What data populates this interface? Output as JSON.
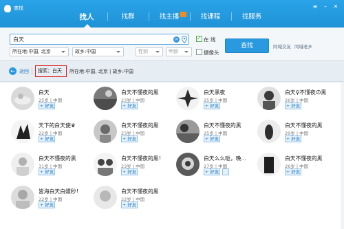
{
  "app": {
    "title": "查找"
  },
  "window": {
    "menu_icon": "menu-icon",
    "minimize_icon": "minimize-icon",
    "close_icon": "close-icon"
  },
  "tabs": [
    {
      "label": "找人",
      "active": true
    },
    {
      "label": "找群",
      "active": false
    },
    {
      "label": "找主播",
      "active": false
    },
    {
      "label": "找课程",
      "active": false
    },
    {
      "label": "找服务",
      "active": false
    }
  ],
  "search": {
    "query": "白天",
    "online_label": "在 线",
    "online_checked": true,
    "camera_label": "摄像头",
    "camera_checked": false,
    "location": "所在地:中国, 北京",
    "hometown": "故乡:中国",
    "gender_placeholder": "性别",
    "age_placeholder": "年龄",
    "button_label": "查找",
    "side_links": [
      "同城交友",
      "同城老乡"
    ]
  },
  "breadcrumb": {
    "back_label": "返回",
    "search_term": "搜索：白天",
    "filters": "所在地:中国, 北京 | 故乡:中国"
  },
  "results": [
    {
      "name": "白天",
      "meta": "25岁 | 中国",
      "add_label": "+ 好友"
    },
    {
      "name": "白天不懂夜的黑",
      "meta": "23岁 | 中国",
      "add_label": "+ 好友"
    },
    {
      "name": "白天黑夜",
      "meta": "25岁 | 中国",
      "add_label": "+ 好友"
    },
    {
      "name": "白天♀不懂夜の黑",
      "meta": "26岁 | 中国",
      "add_label": "+ 好友"
    },
    {
      "name": "天下的白天使♛",
      "meta": "22岁 | 中国",
      "add_label": "+ 好友"
    },
    {
      "name": "白天不懂夜的黑",
      "meta": "23岁 | 中国",
      "add_label": "+ 好友"
    },
    {
      "name": "白天不懂夜的黑",
      "meta": "25岁 | 中国",
      "add_label": "+ 好友"
    },
    {
      "name": "白天不懂夜的黑",
      "meta": "29岁 | 中国",
      "add_label": "+ 好友"
    },
    {
      "name": "白天不懂夜的黑",
      "meta": "31岁 | 中国",
      "add_label": "+ 好友"
    },
    {
      "name": "白天不懂夜的黑！",
      "meta": "23岁 | 中国",
      "add_label": "+ 好友"
    },
    {
      "name": "白天么么哒，晚...",
      "meta": "27岁 | 中国",
      "add_label": "+ 好友"
    },
    {
      "name": "白天不懂夜的黑",
      "meta": "26岁 | 中国",
      "add_label": "+ 好友"
    },
    {
      "name": "皆海白天白嫖秒！",
      "meta": "22岁 | 中国",
      "add_label": "+ 好友"
    },
    {
      "name": "白天不懂夜的黑",
      "meta": "22岁 | 中国",
      "add_label": "+ 好友"
    }
  ]
}
